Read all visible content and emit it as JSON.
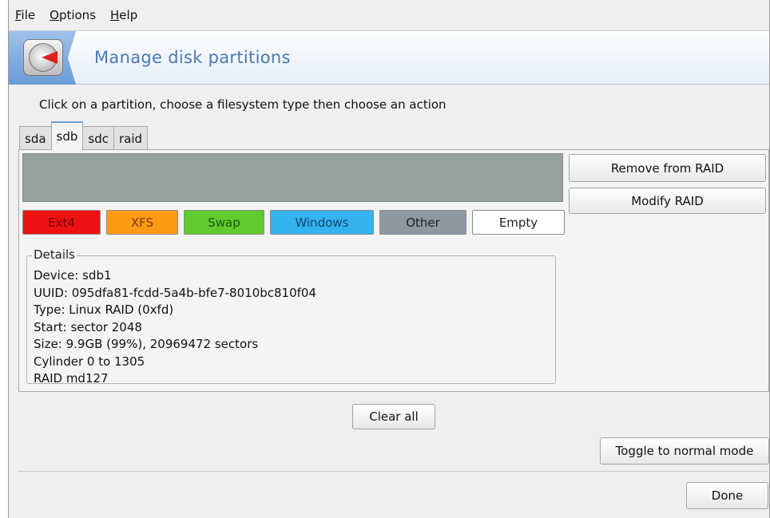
{
  "menu": [
    {
      "mnemonic": "F",
      "rest": "ile"
    },
    {
      "mnemonic": "O",
      "rest": "ptions"
    },
    {
      "mnemonic": "H",
      "rest": "elp"
    }
  ],
  "banner": {
    "title": "Manage disk partitions",
    "icon": "hard-disk-icon"
  },
  "instruction": "Click on a partition, choose a filesystem type then choose an action",
  "tabs": [
    {
      "label": "sda",
      "active": false
    },
    {
      "label": "sdb",
      "active": true
    },
    {
      "label": "sdc",
      "active": false
    },
    {
      "label": "raid",
      "active": false
    }
  ],
  "partition_bar_color": "#97a29c",
  "filesystems": [
    {
      "label": "Ext4",
      "color": "#ee1111",
      "text_color": "#7a0000"
    },
    {
      "label": "XFS",
      "color": "#ff9a14",
      "text_color": "#7a3a00"
    },
    {
      "label": "Swap",
      "color": "#5fcb2e",
      "text_color": "#1b5c0a"
    },
    {
      "label": "Windows",
      "color": "#35b2f0",
      "text_color": "#0d4a6e"
    },
    {
      "label": "Other",
      "color": "#8e98a3",
      "text_color": "#222222"
    },
    {
      "label": "Empty",
      "color": "#ffffff",
      "text_color": "#222222"
    }
  ],
  "details": {
    "legend": "Details",
    "lines": [
      "Device: sdb1",
      "UUID: 095dfa81-fcdd-5a4b-bfe7-8010bc810f04",
      "Type: Linux RAID (0xfd)",
      "Start: sector 2048",
      "Size: 9.9GB (99%), 20969472 sectors",
      "Cylinder 0 to 1305",
      "RAID md127"
    ]
  },
  "actions": {
    "remove_from_raid": "Remove from RAID",
    "modify_raid": "Modify RAID"
  },
  "clear_all": "Clear all",
  "toggle_mode": "Toggle to normal mode",
  "done": "Done"
}
